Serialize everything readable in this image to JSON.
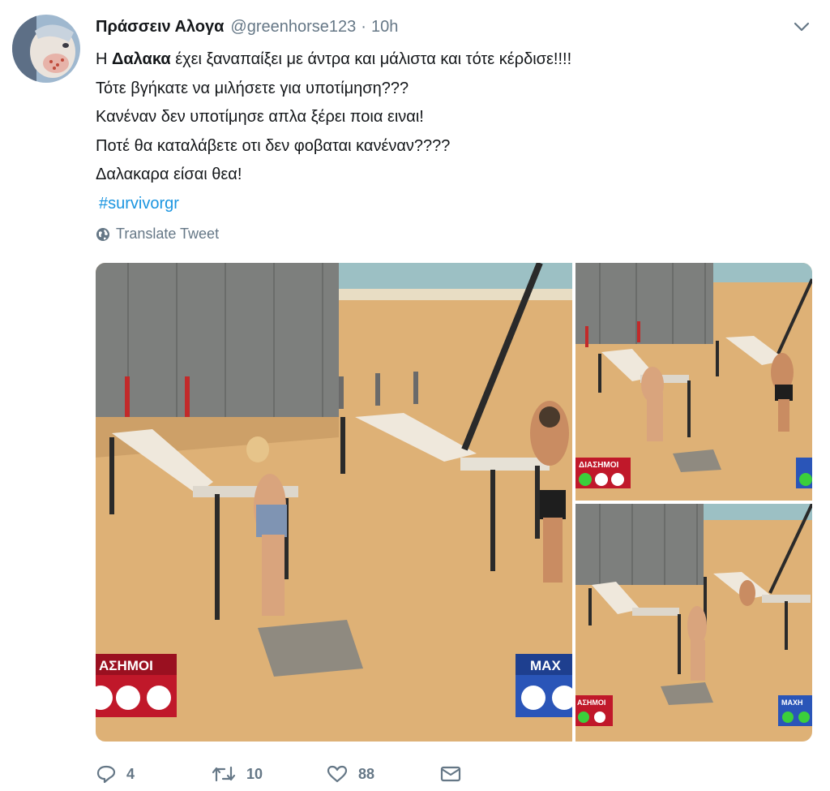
{
  "tweet": {
    "display_name": "Πράσσειν Αλογα",
    "handle": "@greenhorse123",
    "separator": "·",
    "timestamp": "10h",
    "lines": [
      {
        "pre": "Η ",
        "bold": "Δαλακα",
        "post": " έχει ξαναπαίξει με άντρα και μάλιστα και τότε κέρδισε!!!!"
      },
      {
        "text": "Τότε βγήκατε να μιλήσετε για υποτίμηση???"
      },
      {
        "text": "Κανέναν δεν υποτίμησε απλα ξέρει ποια ειναι!"
      },
      {
        "text": "Ποτέ θα καταλάβετε οτι δεν φοβαται κανέναν????"
      },
      {
        "text": "Δαλακαρα είσαι θεα!"
      }
    ],
    "hashtag": "#survivorgr",
    "translate_label": "Translate Tweet"
  },
  "media": {
    "left_label": "ΑΣΗΜΟΙ",
    "left_label_right": "ΜΑΧ",
    "small_label_red": "ΔΙΑΣΗΜΟΙ",
    "small_label_red_2": "ΑΣΗΜΟΙ",
    "small_label_blue": "ΜΑΧΗ"
  },
  "actions": {
    "replies": "4",
    "retweets": "10",
    "likes": "88"
  },
  "icons": {
    "avatar": "avatar",
    "caret": "chevron-down-icon",
    "globe": "globe-icon",
    "reply": "reply-icon",
    "retweet": "retweet-icon",
    "like": "heart-icon",
    "dm": "envelope-icon"
  },
  "colors": {
    "text": "#14171a",
    "secondary": "#657786",
    "link": "#1b95e0",
    "sand": "#e0b074",
    "red_badge": "#c0182a",
    "blue_badge": "#2a55b8"
  }
}
